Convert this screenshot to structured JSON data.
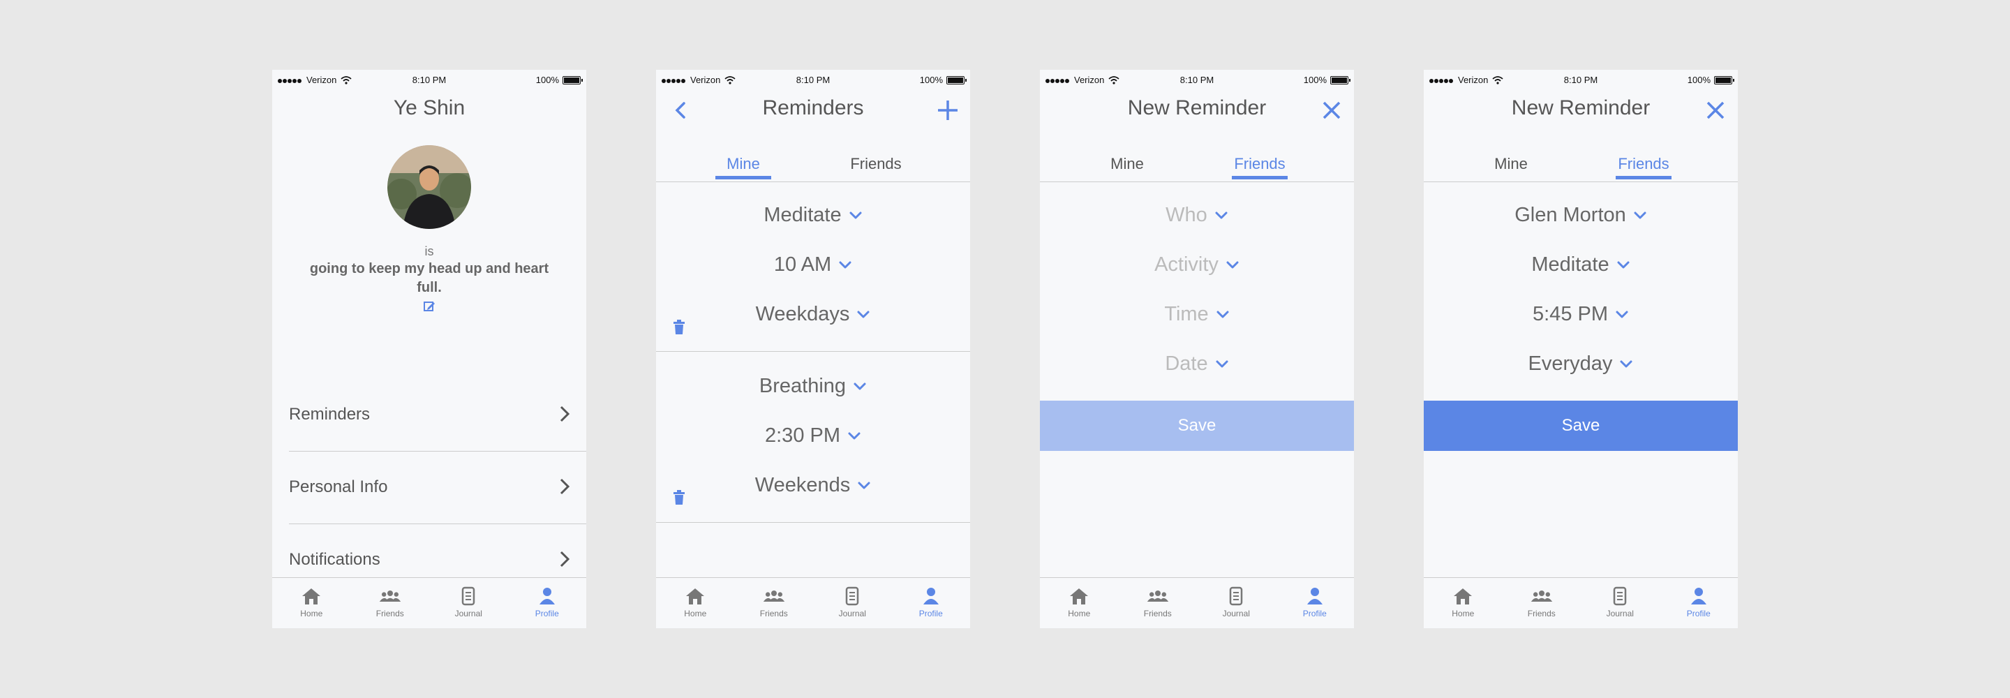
{
  "status_bar": {
    "carrier": "Verizon",
    "time": "8:10 PM",
    "battery": "100%"
  },
  "colors": {
    "accent": "#5b86e5",
    "accent_disabled": "#a7bef0",
    "background": "#f7f8fa",
    "canvas": "#e8e8e8"
  },
  "nav": {
    "items": [
      {
        "label": "Home",
        "icon": "home-icon"
      },
      {
        "label": "Friends",
        "icon": "friends-icon"
      },
      {
        "label": "Journal",
        "icon": "journal-icon"
      },
      {
        "label": "Profile",
        "icon": "profile-icon",
        "active": true
      }
    ]
  },
  "profile_screen": {
    "title": "Ye Shin",
    "is_label": "is",
    "status": "going to keep my head up and heart full.",
    "menu": [
      {
        "label": "Reminders"
      },
      {
        "label": "Personal Info"
      },
      {
        "label": "Notifications"
      }
    ]
  },
  "reminders_screen": {
    "title": "Reminders",
    "tabs": [
      {
        "label": "Mine",
        "active": true
      },
      {
        "label": "Friends"
      }
    ],
    "reminders": [
      {
        "activity": "Meditate",
        "time": "10 AM",
        "days": "Weekdays"
      },
      {
        "activity": "Breathing",
        "time": "2:30 PM",
        "days": "Weekends"
      }
    ]
  },
  "new_reminder_empty": {
    "title": "New Reminder",
    "tabs": [
      {
        "label": "Mine"
      },
      {
        "label": "Friends",
        "active": true
      }
    ],
    "fields": [
      {
        "placeholder": "Who"
      },
      {
        "placeholder": "Activity"
      },
      {
        "placeholder": "Time"
      },
      {
        "placeholder": "Date"
      }
    ],
    "save_label": "Save"
  },
  "new_reminder_filled": {
    "title": "New Reminder",
    "tabs": [
      {
        "label": "Mine"
      },
      {
        "label": "Friends",
        "active": true
      }
    ],
    "fields": [
      {
        "value": "Glen Morton"
      },
      {
        "value": "Meditate"
      },
      {
        "value": "5:45 PM"
      },
      {
        "value": "Everyday"
      }
    ],
    "save_label": "Save"
  }
}
